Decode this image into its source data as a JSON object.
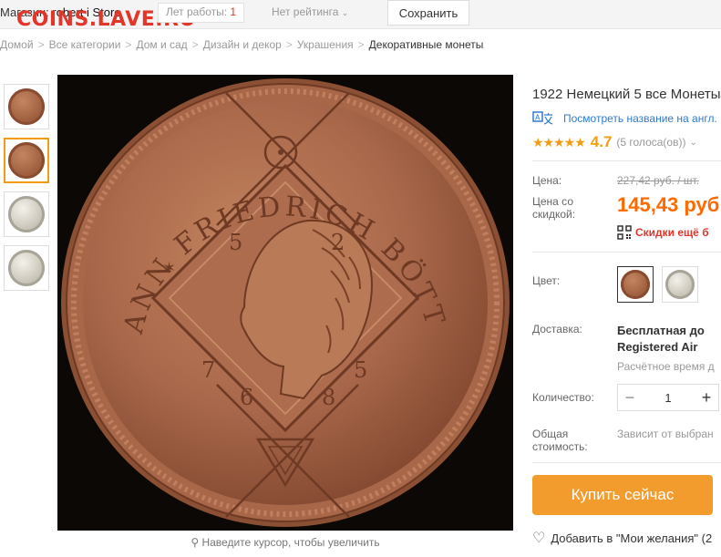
{
  "topbar": {
    "store_label": "Магазин: ",
    "store_name": "robert i Store",
    "watermark": "COINS.LAVE.RU",
    "work_label": "Лет работы: ",
    "work_years": "1",
    "rating_label": "Нет рейтинга",
    "save_label": "Сохранить"
  },
  "breadcrumb": {
    "items": [
      "Домой",
      "Все категории",
      "Дом и сад",
      "Дизайн и декор",
      "Украшения"
    ],
    "current": "Декоративные монеты"
  },
  "gallery": {
    "zoom_hint": "Наведите курсор, чтобы увеличить",
    "coin_lettering": [
      "JOHANN FRIEDRICH BÖTTGER",
      "5",
      "2",
      "7",
      "6",
      "8",
      "5"
    ]
  },
  "product": {
    "title": "1922 Немецкий 5 все Монеты",
    "translate_label": "Посмотреть название на англ.",
    "rating_stars": 4.7,
    "rating_score": "4.7",
    "votes": "(5 голоса(ов))",
    "price_label": "Цена:",
    "old_price": "227,42 руб. / шт.",
    "discount_label": "Цена со скидкой:",
    "new_price": "145,43 руб",
    "extra_discount": "Скидки ещё б",
    "color_label": "Цвет:",
    "shipping_label": "Доставка:",
    "shipping_main_1": "Бесплатная до",
    "shipping_main_2": "Registered Air",
    "shipping_sub": "Расчётное время д",
    "quantity_label": "Количество:",
    "quantity_value": "1",
    "total_label": "Общая стоимость:",
    "total_value": "Зависит от выбран",
    "buy_label": "Купить сейчас",
    "wishlist_label": "Добавить в \"Мои желания\" (2"
  },
  "colors": {
    "brand_orange": "#f39c2e",
    "price_orange": "#ff6a00",
    "link_blue": "#2e7bcf",
    "alert_red": "#e2362a",
    "coin_brown": "#a9694a"
  }
}
